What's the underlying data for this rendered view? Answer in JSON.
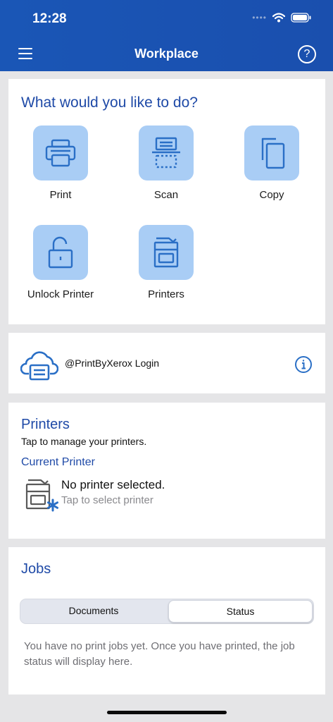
{
  "status_bar": {
    "time": "12:28"
  },
  "nav": {
    "title": "Workplace"
  },
  "actions": {
    "question": "What would you like to do?",
    "tiles": [
      {
        "label": "Print",
        "icon": "printer-icon"
      },
      {
        "label": "Scan",
        "icon": "scanner-icon"
      },
      {
        "label": "Copy",
        "icon": "copy-icon"
      },
      {
        "label": "Unlock Printer",
        "icon": "unlock-icon"
      },
      {
        "label": "Printers",
        "icon": "printer-device-icon"
      }
    ]
  },
  "cloud": {
    "label": "@PrintByXerox  Login"
  },
  "printers": {
    "title": "Printers",
    "subtitle": "Tap to manage your printers.",
    "current_label": "Current Printer",
    "status": "No printer selected.",
    "hint": "Tap to select printer"
  },
  "jobs": {
    "title": "Jobs",
    "tabs": [
      "Documents",
      "Status"
    ],
    "selected_tab": "Status",
    "empty_message": "You have no print jobs yet. Once you have printed, the job status will display here."
  },
  "colors": {
    "brand": "#1a56b6",
    "tile_bg": "#a9cdf5",
    "accent": "#1f4aa7",
    "icon": "#2a6fc6"
  }
}
